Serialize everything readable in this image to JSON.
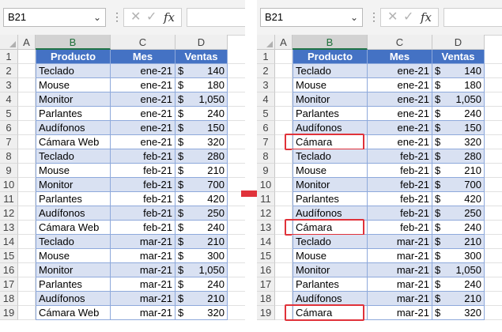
{
  "colors": {
    "header_fill": "#4472c4",
    "band_fill": "#d9e1f2",
    "highlight": "#e0323a",
    "arrow": "#e0323a"
  },
  "icons": {
    "cancel": "close-icon",
    "enter": "check-icon",
    "function": "fx-icon",
    "dropdown": "chevron-down-icon",
    "more": "more-vertical-icon",
    "arrow": "right-arrow-icon"
  },
  "columns": [
    "A",
    "B",
    "C",
    "D"
  ],
  "row_numbers": [
    "1",
    "2",
    "3",
    "4",
    "5",
    "6",
    "7",
    "8",
    "9",
    "10",
    "11",
    "12",
    "13",
    "14",
    "15",
    "16",
    "17",
    "18",
    "19"
  ],
  "left": {
    "formula_bar": {
      "name_box": "B21",
      "cancel": "✕",
      "enter": "✓",
      "fx": "fx",
      "formula": ""
    },
    "table": {
      "headers": [
        "Producto",
        "Mes",
        "Ventas"
      ],
      "rows": [
        {
          "producto": "Teclado",
          "mes": "ene-21",
          "cur": "$",
          "val": "140"
        },
        {
          "producto": "Mouse",
          "mes": "ene-21",
          "cur": "$",
          "val": "180"
        },
        {
          "producto": "Monitor",
          "mes": "ene-21",
          "cur": "$",
          "val": "1,050"
        },
        {
          "producto": "Parlantes",
          "mes": "ene-21",
          "cur": "$",
          "val": "240"
        },
        {
          "producto": "Audífonos",
          "mes": "ene-21",
          "cur": "$",
          "val": "150"
        },
        {
          "producto": "Cámara Web",
          "mes": "ene-21",
          "cur": "$",
          "val": "320"
        },
        {
          "producto": "Teclado",
          "mes": "feb-21",
          "cur": "$",
          "val": "280"
        },
        {
          "producto": "Mouse",
          "mes": "feb-21",
          "cur": "$",
          "val": "210"
        },
        {
          "producto": "Monitor",
          "mes": "feb-21",
          "cur": "$",
          "val": "700"
        },
        {
          "producto": "Parlantes",
          "mes": "feb-21",
          "cur": "$",
          "val": "420"
        },
        {
          "producto": "Audífonos",
          "mes": "feb-21",
          "cur": "$",
          "val": "250"
        },
        {
          "producto": "Cámara Web",
          "mes": "feb-21",
          "cur": "$",
          "val": "240"
        },
        {
          "producto": "Teclado",
          "mes": "mar-21",
          "cur": "$",
          "val": "210"
        },
        {
          "producto": "Mouse",
          "mes": "mar-21",
          "cur": "$",
          "val": "300"
        },
        {
          "producto": "Monitor",
          "mes": "mar-21",
          "cur": "$",
          "val": "1,050"
        },
        {
          "producto": "Parlantes",
          "mes": "mar-21",
          "cur": "$",
          "val": "240"
        },
        {
          "producto": "Audífonos",
          "mes": "mar-21",
          "cur": "$",
          "val": "210"
        },
        {
          "producto": "Cámara Web",
          "mes": "mar-21",
          "cur": "$",
          "val": "320"
        }
      ]
    }
  },
  "right": {
    "formula_bar": {
      "name_box": "B21",
      "cancel": "✕",
      "enter": "✓",
      "fx": "fx",
      "formula": ""
    },
    "table": {
      "headers": [
        "Producto",
        "Mes",
        "Ventas"
      ],
      "rows": [
        {
          "producto": "Teclado",
          "mes": "ene-21",
          "cur": "$",
          "val": "140"
        },
        {
          "producto": "Mouse",
          "mes": "ene-21",
          "cur": "$",
          "val": "180"
        },
        {
          "producto": "Monitor",
          "mes": "ene-21",
          "cur": "$",
          "val": "1,050"
        },
        {
          "producto": "Parlantes",
          "mes": "ene-21",
          "cur": "$",
          "val": "240"
        },
        {
          "producto": "Audífonos",
          "mes": "ene-21",
          "cur": "$",
          "val": "150"
        },
        {
          "producto": "Cámara",
          "mes": "ene-21",
          "cur": "$",
          "val": "320",
          "highlight": true
        },
        {
          "producto": "Teclado",
          "mes": "feb-21",
          "cur": "$",
          "val": "280"
        },
        {
          "producto": "Mouse",
          "mes": "feb-21",
          "cur": "$",
          "val": "210"
        },
        {
          "producto": "Monitor",
          "mes": "feb-21",
          "cur": "$",
          "val": "700"
        },
        {
          "producto": "Parlantes",
          "mes": "feb-21",
          "cur": "$",
          "val": "420"
        },
        {
          "producto": "Audífonos",
          "mes": "feb-21",
          "cur": "$",
          "val": "250"
        },
        {
          "producto": "Cámara",
          "mes": "feb-21",
          "cur": "$",
          "val": "240",
          "highlight": true
        },
        {
          "producto": "Teclado",
          "mes": "mar-21",
          "cur": "$",
          "val": "210"
        },
        {
          "producto": "Mouse",
          "mes": "mar-21",
          "cur": "$",
          "val": "300"
        },
        {
          "producto": "Monitor",
          "mes": "mar-21",
          "cur": "$",
          "val": "1,050"
        },
        {
          "producto": "Parlantes",
          "mes": "mar-21",
          "cur": "$",
          "val": "240"
        },
        {
          "producto": "Audífonos",
          "mes": "mar-21",
          "cur": "$",
          "val": "210"
        },
        {
          "producto": "Cámara",
          "mes": "mar-21",
          "cur": "$",
          "val": "320",
          "highlight": true
        }
      ]
    }
  }
}
